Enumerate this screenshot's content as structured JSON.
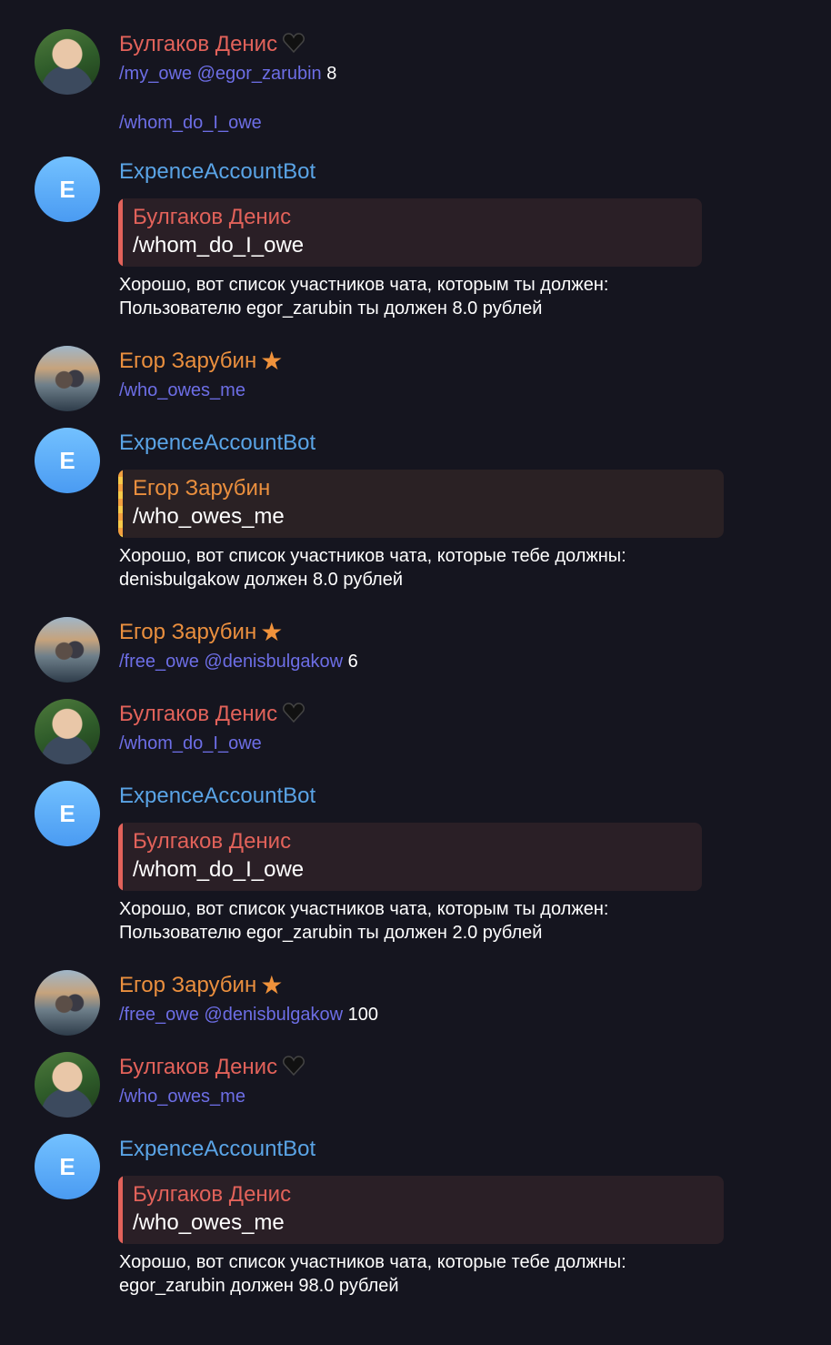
{
  "messages": [
    {
      "sender": "Булгаков Денис",
      "line1_cmd": "/my_owe @egor_zarubin",
      "line1_value": "8",
      "line2_cmd": "/whom_do_I_owe"
    },
    {
      "sender": "ExpenceAccountBot",
      "avatar_letter": "E",
      "quote_name": "Булгаков Денис",
      "quote_text": "/whom_do_I_owe",
      "reply_line1": "Хорошо, вот список участников чата, которым ты должен:",
      "reply_line2": "Пользователю egor_zarubin ты должен 8.0 рублей"
    },
    {
      "sender": "Егор Зарубин",
      "line1_cmd": "/who_owes_me"
    },
    {
      "sender": "ExpenceAccountBot",
      "avatar_letter": "E",
      "quote_name": "Егор Зарубин",
      "quote_text": "/who_owes_me",
      "reply_line1": "Хорошо, вот список участников чата, которые тебе должны:",
      "reply_line2": "denisbulgakow должен 8.0 рублей"
    },
    {
      "sender": "Егор Зарубин",
      "line1_cmd": "/free_owe @denisbulgakow",
      "line1_value": "6"
    },
    {
      "sender": "Булгаков Денис",
      "line1_cmd": "/whom_do_I_owe"
    },
    {
      "sender": "ExpenceAccountBot",
      "avatar_letter": "E",
      "quote_name": "Булгаков Денис",
      "quote_text": "/whom_do_I_owe",
      "reply_line1": "Хорошо, вот список участников чата, которым ты должен:",
      "reply_line2": "Пользователю egor_zarubin ты должен 2.0 рублей"
    },
    {
      "sender": "Егор Зарубин",
      "line1_cmd": "/free_owe @denisbulgakow",
      "line1_value": "100"
    },
    {
      "sender": "Булгаков Денис",
      "line1_cmd": "/who_owes_me"
    },
    {
      "sender": "ExpenceAccountBot",
      "avatar_letter": "E",
      "quote_name": "Булгаков Денис",
      "quote_text": "/who_owes_me",
      "reply_line1": "Хорошо, вот список участников чата, которые тебе должны:",
      "reply_line2": "egor_zarubin должен 98.0 рублей"
    }
  ],
  "colors": {
    "background": "#15151f",
    "denis_name": "#e2625a",
    "egor_name": "#ea8f3e",
    "bot_name": "#5aa4e6",
    "command_link": "#6d6ee6"
  },
  "icons": {
    "denis_badge": "black-heart-icon",
    "egor_badge": "star-icon"
  }
}
